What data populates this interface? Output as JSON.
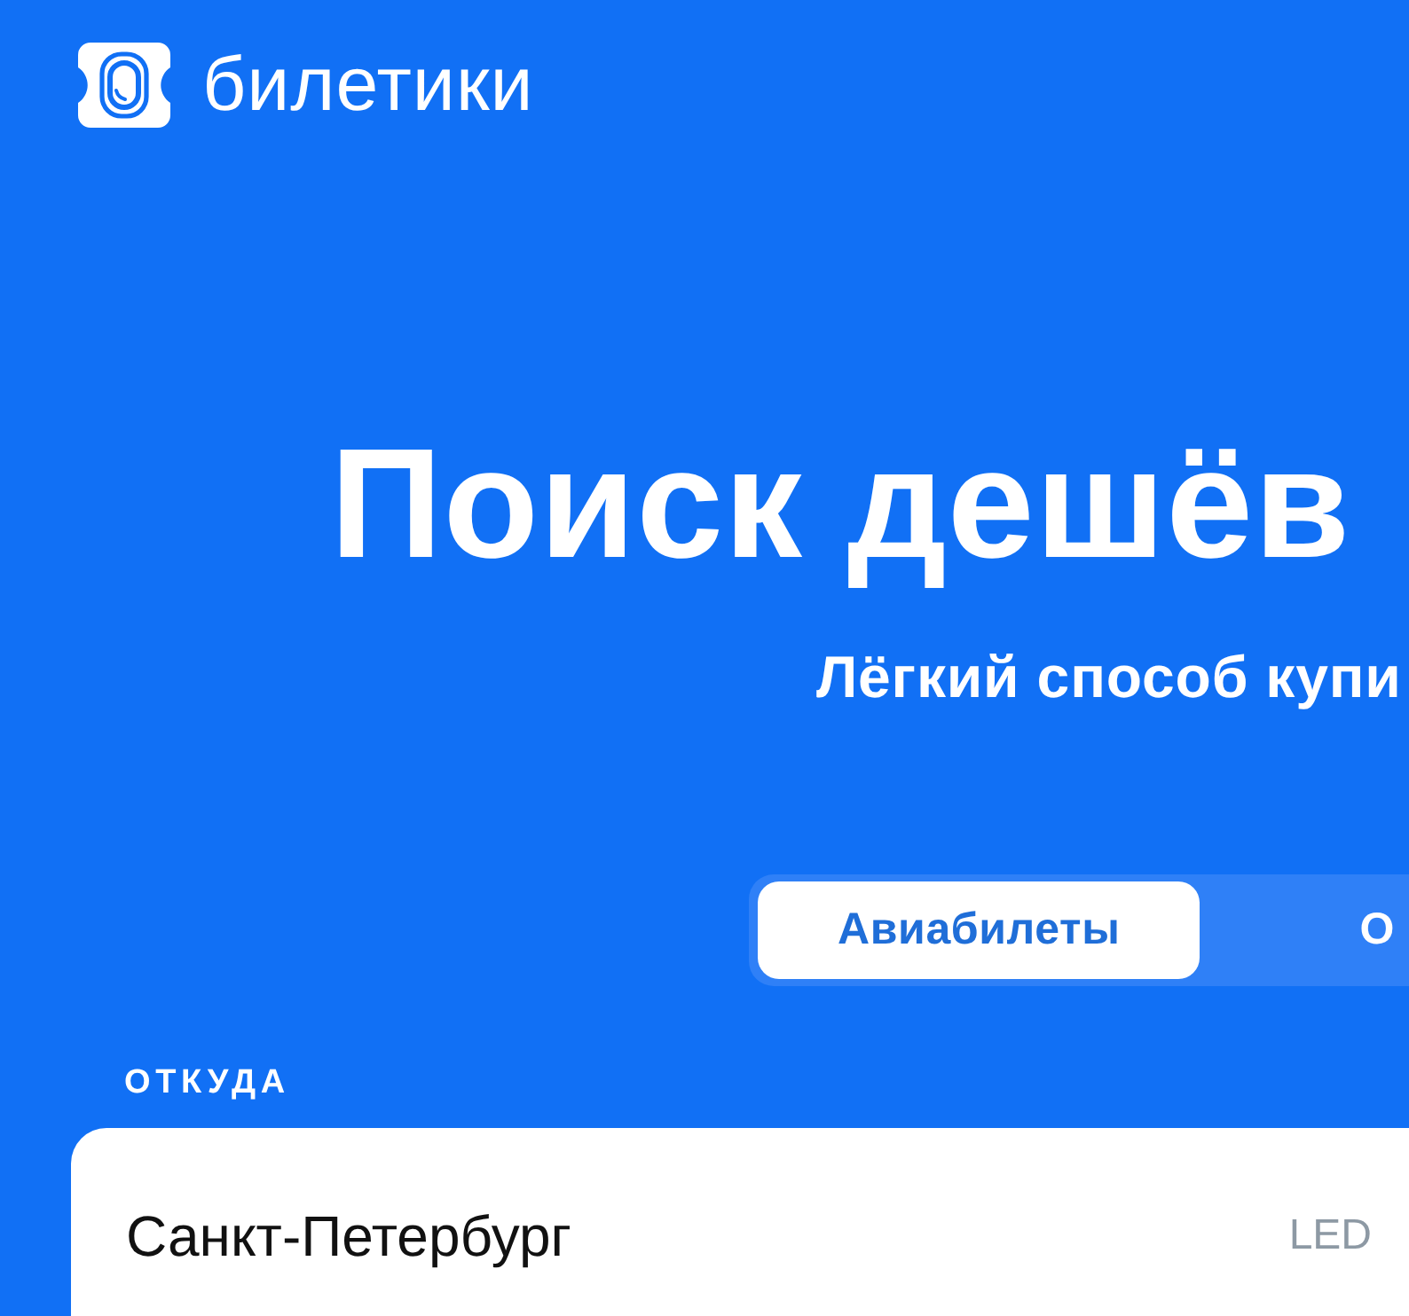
{
  "brand": {
    "name": "билетики"
  },
  "hero": {
    "title": "Поиск дешёв",
    "subtitle": "Лёгкий способ купи"
  },
  "tabs": [
    {
      "label": "Авиабилеты",
      "selected": true
    },
    {
      "label": "О",
      "selected": false
    }
  ],
  "search_form": {
    "fields": [
      {
        "label": "ОТКУДА",
        "value": "Санкт-Петербург",
        "code": "LED"
      }
    ]
  }
}
